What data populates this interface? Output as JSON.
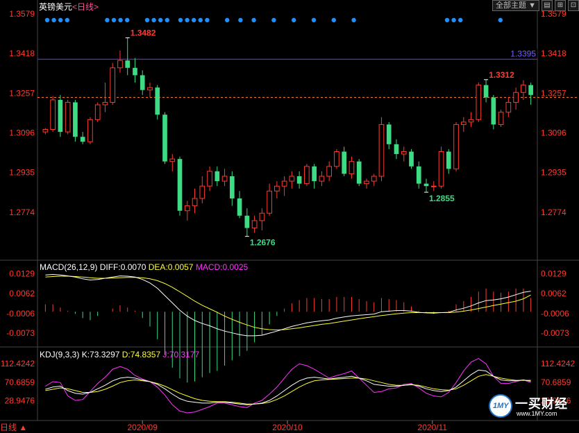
{
  "header": {
    "symbol": "英镑美元",
    "period": "<日线>"
  },
  "toolbar": {
    "dropdown": "全部主题",
    "dropdown_arrow": "▼",
    "icon1": "▤",
    "icon2": "⊞",
    "icon3": "⊡"
  },
  "bottom_bar": {
    "label": "日线 ▲"
  },
  "logo": {
    "brand": "一买财经",
    "url": "www.1MY.com",
    "badge": "1MY"
  },
  "colors": {
    "up": "#ff3b30",
    "down": "#3ddc84",
    "macd": "#ff3b30",
    "dea": "#ffff33",
    "diff": "#ffffff",
    "j": "#ff33ff",
    "hline": "#5a3bd6"
  },
  "chart_data": [
    {
      "type": "candlestick",
      "title": "英镑美元<日线>",
      "ylim": [
        1.2613,
        1.3579
      ],
      "y_ticks": [
        "1.3579",
        "1.3418",
        "1.3257",
        "1.3096",
        "1.2935",
        "1.2774"
      ],
      "x_ticks": [
        "2020/09",
        "2020/10",
        "2020/11"
      ],
      "annotations": [
        {
          "label": "1.3482",
          "type": "high"
        },
        {
          "label": "1.2676",
          "type": "low"
        },
        {
          "label": "1.2855",
          "type": "low"
        },
        {
          "label": "1.3312",
          "type": "high"
        },
        {
          "label": "1.3395",
          "type": "hline"
        }
      ],
      "current_price_line": 1.324,
      "candles": [
        [
          1.31,
          1.311,
          1.309,
          1.3115
        ],
        [
          1.311,
          1.323,
          1.31,
          1.3245
        ],
        [
          1.323,
          1.31,
          1.308,
          1.325
        ],
        [
          1.31,
          1.322,
          1.309,
          1.323
        ],
        [
          1.322,
          1.308,
          1.306,
          1.323
        ],
        [
          1.308,
          1.306,
          1.305,
          1.31
        ],
        [
          1.306,
          1.315,
          1.305,
          1.316
        ],
        [
          1.315,
          1.321,
          1.314,
          1.322
        ],
        [
          1.321,
          1.322,
          1.318,
          1.33
        ],
        [
          1.322,
          1.336,
          1.321,
          1.338
        ],
        [
          1.336,
          1.339,
          1.334,
          1.343
        ],
        [
          1.339,
          1.336,
          1.333,
          1.3482
        ],
        [
          1.336,
          1.333,
          1.33,
          1.34
        ],
        [
          1.333,
          1.327,
          1.325,
          1.335
        ],
        [
          1.327,
          1.328,
          1.324,
          1.33
        ],
        [
          1.328,
          1.317,
          1.315,
          1.329
        ],
        [
          1.317,
          1.298,
          1.297,
          1.318
        ],
        [
          1.298,
          1.299,
          1.294,
          1.301
        ],
        [
          1.299,
          1.278,
          1.276,
          1.3
        ],
        [
          1.278,
          1.28,
          1.274,
          1.282
        ],
        [
          1.28,
          1.283,
          1.277,
          1.287
        ],
        [
          1.283,
          1.288,
          1.281,
          1.292
        ],
        [
          1.288,
          1.294,
          1.286,
          1.296
        ],
        [
          1.294,
          1.29,
          1.288,
          1.296
        ],
        [
          1.29,
          1.292,
          1.288,
          1.295
        ],
        [
          1.292,
          1.283,
          1.28,
          1.294
        ],
        [
          1.283,
          1.276,
          1.275,
          1.286
        ],
        [
          1.276,
          1.271,
          1.2676,
          1.279
        ],
        [
          1.271,
          1.274,
          1.269,
          1.276
        ],
        [
          1.274,
          1.277,
          1.27,
          1.279
        ],
        [
          1.277,
          1.286,
          1.276,
          1.289
        ],
        [
          1.286,
          1.288,
          1.283,
          1.29
        ],
        [
          1.288,
          1.29,
          1.284,
          1.292
        ],
        [
          1.29,
          1.292,
          1.287,
          1.294
        ],
        [
          1.292,
          1.289,
          1.287,
          1.294
        ],
        [
          1.289,
          1.296,
          1.288,
          1.297
        ],
        [
          1.296,
          1.29,
          1.287,
          1.297
        ],
        [
          1.29,
          1.292,
          1.288,
          1.294
        ],
        [
          1.292,
          1.296,
          1.29,
          1.298
        ],
        [
          1.296,
          1.302,
          1.295,
          1.303
        ],
        [
          1.302,
          1.293,
          1.292,
          1.304
        ],
        [
          1.293,
          1.298,
          1.291,
          1.3
        ],
        [
          1.298,
          1.289,
          1.288,
          1.299
        ],
        [
          1.289,
          1.29,
          1.287,
          1.291
        ],
        [
          1.29,
          1.292,
          1.288,
          1.293
        ],
        [
          1.292,
          1.313,
          1.29,
          1.316
        ],
        [
          1.313,
          1.305,
          1.303,
          1.314
        ],
        [
          1.305,
          1.301,
          1.299,
          1.307
        ],
        [
          1.301,
          1.302,
          1.298,
          1.304
        ],
        [
          1.302,
          1.296,
          1.295,
          1.303
        ],
        [
          1.296,
          1.289,
          1.287,
          1.298
        ],
        [
          1.289,
          1.288,
          1.2855,
          1.291
        ],
        [
          1.288,
          1.288,
          1.286,
          1.29
        ],
        [
          1.288,
          1.302,
          1.287,
          1.304
        ],
        [
          1.302,
          1.295,
          1.293,
          1.303
        ],
        [
          1.295,
          1.313,
          1.294,
          1.314
        ],
        [
          1.313,
          1.314,
          1.31,
          1.316
        ],
        [
          1.314,
          1.315,
          1.312,
          1.318
        ],
        [
          1.315,
          1.329,
          1.314,
          1.33
        ],
        [
          1.329,
          1.324,
          1.322,
          1.3312
        ],
        [
          1.324,
          1.313,
          1.311,
          1.325
        ],
        [
          1.313,
          1.318,
          1.312,
          1.319
        ],
        [
          1.318,
          1.322,
          1.316,
          1.324
        ],
        [
          1.322,
          1.326,
          1.319,
          1.328
        ],
        [
          1.326,
          1.329,
          1.323,
          1.331
        ],
        [
          1.329,
          1.325,
          1.321,
          1.33
        ]
      ]
    },
    {
      "type": "bar+line",
      "title": "MACD(26,12,9)",
      "legend": [
        {
          "name": "DIFF",
          "value": "0.0070",
          "label": "DIFF:0.0070"
        },
        {
          "name": "DEA",
          "value": "0.0057",
          "label": "DEA:0.0057"
        },
        {
          "name": "MACD",
          "value": "0.0025",
          "label": "MACD:0.0025"
        }
      ],
      "ylim": [
        -0.012,
        0.014
      ],
      "y_ticks": [
        "0.0129",
        "0.0062",
        "-0.0006",
        "-0.0073"
      ],
      "diff": [
        0.0125,
        0.0127,
        0.0125,
        0.0122,
        0.0118,
        0.0112,
        0.0108,
        0.011,
        0.0114,
        0.0118,
        0.0122,
        0.0121,
        0.0118,
        0.011,
        0.0098,
        0.008,
        0.0055,
        0.003,
        0.0005,
        -0.0015,
        -0.003,
        -0.004,
        -0.0048,
        -0.0058,
        -0.0066,
        -0.0072,
        -0.0078,
        -0.0082,
        -0.0082,
        -0.008,
        -0.0073,
        -0.0066,
        -0.0058,
        -0.005,
        -0.0044,
        -0.0038,
        -0.0034,
        -0.0031,
        -0.0028,
        -0.0022,
        -0.0018,
        -0.0014,
        -0.0012,
        -0.001,
        -0.0008,
        0.0,
        0.0002,
        0.0004,
        0.0004,
        0.0002,
        -0.0002,
        -0.0004,
        -0.0005,
        -0.0003,
        -0.0002,
        0.0006,
        0.0012,
        0.002,
        0.003,
        0.0038,
        0.004,
        0.0044,
        0.005,
        0.0058,
        0.0066,
        0.007
      ],
      "dea": [
        0.0118,
        0.012,
        0.0121,
        0.0121,
        0.012,
        0.0118,
        0.0116,
        0.0114,
        0.0114,
        0.0115,
        0.0116,
        0.0117,
        0.0117,
        0.0116,
        0.0112,
        0.0106,
        0.0096,
        0.0083,
        0.0068,
        0.0052,
        0.0036,
        0.0022,
        0.001,
        -0.0002,
        -0.0015,
        -0.0026,
        -0.0036,
        -0.0045,
        -0.0053,
        -0.0058,
        -0.0061,
        -0.0062,
        -0.0061,
        -0.0058,
        -0.0055,
        -0.0051,
        -0.0047,
        -0.0043,
        -0.004,
        -0.0036,
        -0.0032,
        -0.0028,
        -0.0024,
        -0.002,
        -0.0017,
        -0.0013,
        -0.001,
        -0.0007,
        -0.0005,
        -0.0003,
        -0.0003,
        -0.0003,
        -0.0003,
        -0.0003,
        -0.0003,
        -0.0001,
        0.0002,
        0.0006,
        0.0011,
        0.0016,
        0.0021,
        0.0026,
        0.0031,
        0.0036,
        0.0044,
        0.0057
      ]
    },
    {
      "type": "line",
      "title": "KDJ(9,3,3)",
      "legend": [
        {
          "name": "K",
          "value": "73.3297",
          "label": "K:73.3297"
        },
        {
          "name": "D",
          "value": "74.8357",
          "label": "D:74.8357"
        },
        {
          "name": "J",
          "value": "70.3177",
          "label": "J:70.3177"
        }
      ],
      "ylim": [
        -12,
        125
      ],
      "y_ticks": [
        "112.4242",
        "70.6859",
        "28.9476"
      ],
      "k": [
        55,
        60,
        62,
        52,
        46,
        44,
        48,
        56,
        64,
        74,
        80,
        82,
        80,
        76,
        72,
        66,
        56,
        44,
        34,
        28,
        26,
        24,
        24,
        26,
        26,
        24,
        22,
        20,
        22,
        24,
        30,
        40,
        52,
        64,
        74,
        80,
        82,
        80,
        78,
        80,
        82,
        84,
        80,
        74,
        66,
        64,
        62,
        62,
        64,
        66,
        62,
        56,
        52,
        50,
        52,
        60,
        74,
        88,
        98,
        96,
        84,
        76,
        74,
        74,
        76,
        73
      ],
      "d": [
        52,
        55,
        58,
        56,
        52,
        48,
        48,
        50,
        55,
        62,
        70,
        74,
        76,
        74,
        72,
        68,
        62,
        54,
        46,
        40,
        34,
        30,
        28,
        27,
        27,
        26,
        24,
        22,
        22,
        23,
        26,
        32,
        40,
        50,
        60,
        68,
        74,
        76,
        77,
        78,
        79,
        80,
        80,
        78,
        74,
        70,
        66,
        64,
        64,
        65,
        64,
        60,
        56,
        54,
        53,
        56,
        64,
        74,
        84,
        88,
        84,
        80,
        77,
        75,
        75,
        75
      ],
      "j": [
        62,
        72,
        70,
        40,
        30,
        32,
        50,
        68,
        82,
        100,
        106,
        100,
        86,
        78,
        72,
        60,
        42,
        20,
        6,
        2,
        4,
        10,
        16,
        24,
        24,
        20,
        16,
        14,
        24,
        30,
        44,
        60,
        80,
        100,
        112,
        108,
        100,
        90,
        80,
        86,
        90,
        96,
        80,
        64,
        48,
        50,
        56,
        58,
        66,
        68,
        58,
        46,
        40,
        38,
        48,
        70,
        96,
        116,
        124,
        112,
        84,
        68,
        68,
        72,
        76,
        70
      ]
    }
  ]
}
